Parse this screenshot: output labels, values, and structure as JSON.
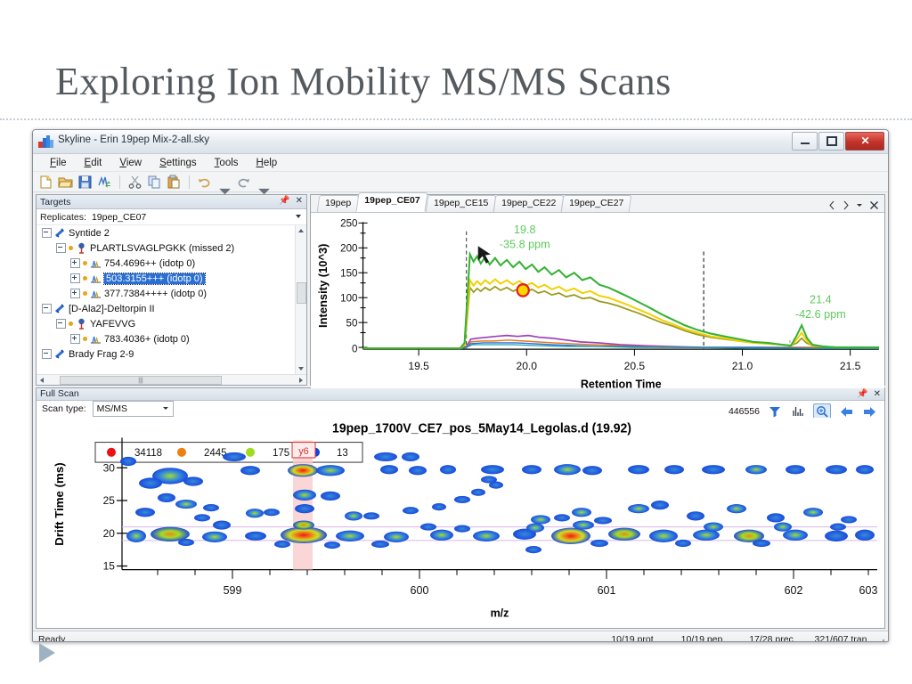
{
  "slide": {
    "title": "Exploring Ion Mobility MS/MS Scans"
  },
  "window": {
    "title": "Skyline - Erin 19pep Mix-2-all.sky",
    "icon": "skyline-app-icon",
    "controls": {
      "minimize": "minimize-icon",
      "maximize": "maximize-icon",
      "close": "close-icon",
      "close_glyph": "✕"
    }
  },
  "menu": {
    "items": [
      "File",
      "Edit",
      "View",
      "Settings",
      "Tools",
      "Help"
    ]
  },
  "toolbar": {
    "buttons": [
      {
        "name": "new-document-icon",
        "tip": "New"
      },
      {
        "name": "open-document-icon",
        "tip": "Open"
      },
      {
        "name": "save-document-icon",
        "tip": "Save"
      },
      {
        "name": "import-results-icon",
        "tip": "Import Results"
      },
      {
        "name": "cut-icon",
        "tip": "Cut"
      },
      {
        "name": "copy-icon",
        "tip": "Copy"
      },
      {
        "name": "paste-icon",
        "tip": "Paste"
      },
      {
        "name": "undo-icon",
        "tip": "Undo"
      },
      {
        "name": "redo-icon",
        "tip": "Redo"
      }
    ]
  },
  "targets": {
    "header": "Targets",
    "pin_icon": "pin-icon",
    "close_icon": "close-icon",
    "replicates_label": "Replicates:",
    "replicates_value": "19pep_CE07",
    "tree": [
      {
        "label": "Syntide 2",
        "level": 0,
        "icon": "protein-icon",
        "expander": "minus",
        "selected": false
      },
      {
        "label": "PLARTLSVAGLPGKK (missed 2)",
        "level": 1,
        "icon": "peptide-icon",
        "expander": "minus",
        "selected": false
      },
      {
        "label": "754.4696++ (idotp 0)",
        "level": 2,
        "icon": "precursor-icon",
        "expander": "plus",
        "selected": false
      },
      {
        "label": "503.3155+++ (idotp 0)",
        "level": 2,
        "icon": "precursor-icon",
        "expander": "plus",
        "selected": true
      },
      {
        "label": "377.7384++++ (idotp 0)",
        "level": 2,
        "icon": "precursor-icon",
        "expander": "plus",
        "selected": false
      },
      {
        "label": "[D-Ala2]-Deltorpin II",
        "level": 0,
        "icon": "protein-icon",
        "expander": "minus",
        "selected": false
      },
      {
        "label": "YAFEVVG",
        "level": 1,
        "icon": "peptide-icon",
        "expander": "minus",
        "selected": false
      },
      {
        "label": "783.4036+ (idotp 0)",
        "level": 2,
        "icon": "precursor-icon",
        "expander": "plus",
        "selected": false
      },
      {
        "label": "Brady Frag 2-9",
        "level": 0,
        "icon": "protein-icon",
        "expander": "minus",
        "selected": false
      }
    ]
  },
  "chromatogram_panel": {
    "tabs": [
      {
        "label": "19pep",
        "active": false
      },
      {
        "label": "19pep_CE07",
        "active": true
      },
      {
        "label": "19pep_CE15",
        "active": false
      },
      {
        "label": "19pep_CE22",
        "active": false
      },
      {
        "label": "19pep_CE27",
        "active": false
      }
    ],
    "tools": {
      "prev_icon": "prev-arrow-icon",
      "next_icon": "next-arrow-icon",
      "menu_icon": "chevron-down-icon",
      "close_icon": "close-icon"
    }
  },
  "full_scan": {
    "header": "Full Scan",
    "pin_icon": "pin-icon",
    "close_icon": "close-icon",
    "scan_type_label": "Scan type:",
    "scan_type_value": "MS/MS",
    "count": "446556",
    "tools": [
      {
        "name": "filter-icon",
        "active": false
      },
      {
        "name": "spectrum-icon",
        "active": false
      },
      {
        "name": "zoom-icon",
        "active": true
      },
      {
        "name": "back-arrow-icon",
        "active": false
      },
      {
        "name": "forward-arrow-icon",
        "active": false
      }
    ]
  },
  "status_bar": {
    "message": "Ready",
    "cells": [
      "10/19 prot",
      "10/19 pep",
      "17/28 prec",
      "321/607 tran"
    ],
    "grip_icon": "resize-grip-icon"
  },
  "chart_data": [
    {
      "id": "chromatogram",
      "type": "line",
      "title": "",
      "xlabel": "Retention Time",
      "ylabel": "Intensity (10^3)",
      "xlim": [
        19.22,
        21.62
      ],
      "ylim": [
        0,
        262
      ],
      "xticks": [
        19.5,
        20.0,
        20.5,
        21.0,
        21.5
      ],
      "xticklabels": [
        "19.5",
        "20.0",
        "20.5",
        "21.0",
        "21.5"
      ],
      "yticks": [
        0,
        50,
        100,
        150,
        200,
        250
      ],
      "yticklabels": [
        "0",
        "50",
        "100",
        "150",
        "200",
        "250"
      ],
      "grid": false,
      "annotations": [
        {
          "text": "19.8",
          "sub": "-35.8 ppm",
          "x": 19.98,
          "y": 238,
          "color": "#5ec95e"
        },
        {
          "text": "21.4",
          "sub": "-42.6 ppm",
          "x": 21.27,
          "y": 92,
          "color": "#5ec95e"
        }
      ],
      "markers": [
        {
          "name": "retention-time-marker",
          "x": 19.72,
          "style": "dashed"
        },
        {
          "name": "retention-time-marker-2",
          "x": 20.82,
          "style": "dashed"
        }
      ],
      "peak_marker": {
        "name": "selected-peak-dot",
        "x": 19.92,
        "y": 133,
        "fill": "#ffd700",
        "stroke": "#e02020"
      },
      "cursor": {
        "name": "cursor-arrow",
        "x": 19.76,
        "y": 196
      },
      "series": [
        {
          "name": "transition-green",
          "color": "#34b233",
          "x": [
            19.22,
            19.4,
            19.6,
            19.7,
            19.73,
            19.76,
            19.79,
            19.82,
            19.86,
            19.9,
            19.94,
            19.98,
            20.02,
            20.06,
            20.1,
            20.14,
            20.18,
            20.22,
            20.26,
            20.3,
            20.34,
            20.38,
            20.42,
            20.46,
            20.5,
            20.56,
            20.62,
            20.7,
            20.8,
            20.95,
            21.1,
            21.25,
            21.35,
            21.4,
            21.45,
            21.55,
            21.62
          ],
          "y": [
            1,
            1,
            1,
            2,
            12,
            190,
            175,
            185,
            168,
            172,
            178,
            160,
            172,
            150,
            160,
            138,
            148,
            128,
            140,
            120,
            128,
            112,
            118,
            100,
            95,
            72,
            58,
            42,
            28,
            18,
            13,
            11,
            9,
            26,
            9,
            7,
            6
          ]
        },
        {
          "name": "transition-yellow",
          "color": "#f2d000",
          "x": [
            19.22,
            19.4,
            19.6,
            19.7,
            19.73,
            19.76,
            19.79,
            19.82,
            19.86,
            19.9,
            19.94,
            19.98,
            20.02,
            20.06,
            20.1,
            20.14,
            20.18,
            20.22,
            20.26,
            20.3,
            20.34,
            20.38,
            20.42,
            20.46,
            20.5,
            20.56,
            20.62,
            20.7,
            20.8,
            20.95,
            21.1,
            21.25,
            21.35,
            21.4,
            21.45,
            21.55,
            21.62
          ],
          "y": [
            1,
            1,
            1,
            2,
            10,
            138,
            126,
            133,
            122,
            128,
            132,
            118,
            128,
            112,
            120,
            104,
            110,
            96,
            102,
            86,
            92,
            80,
            84,
            70,
            66,
            50,
            40,
            30,
            20,
            13,
            9,
            8,
            7,
            16,
            7,
            5,
            5
          ]
        },
        {
          "name": "transition-olive",
          "color": "#9a9a1c",
          "x": [
            19.22,
            19.4,
            19.6,
            19.7,
            19.73,
            19.76,
            19.79,
            19.82,
            19.86,
            19.9,
            19.94,
            19.98,
            20.02,
            20.06,
            20.1,
            20.14,
            20.18,
            20.22,
            20.26,
            20.3,
            20.34,
            20.38,
            20.42,
            20.46,
            20.5,
            20.56,
            20.62,
            20.7,
            20.8,
            20.95,
            21.1,
            21.25,
            21.35,
            21.4,
            21.45,
            21.55,
            21.62
          ],
          "y": [
            1,
            1,
            1,
            2,
            8,
            124,
            112,
            117,
            108,
            112,
            118,
            104,
            112,
            96,
            104,
            88,
            94,
            80,
            86,
            72,
            78,
            66,
            70,
            58,
            54,
            40,
            32,
            24,
            16,
            10,
            8,
            7,
            6,
            12,
            6,
            5,
            4
          ]
        },
        {
          "name": "transition-purple",
          "color": "#9b3fb5",
          "x": [
            19.22,
            19.4,
            19.6,
            19.7,
            19.73,
            19.76,
            19.8,
            19.86,
            19.92,
            19.98,
            20.06,
            20.14,
            20.22,
            20.32,
            20.42,
            20.52,
            20.65,
            20.8,
            21.0,
            21.2,
            21.4,
            21.62
          ],
          "y": [
            1,
            1,
            1,
            2,
            4,
            20,
            22,
            24,
            26,
            28,
            26,
            28,
            24,
            22,
            18,
            14,
            11,
            8,
            6,
            5,
            6,
            5
          ]
        },
        {
          "name": "transition-orange",
          "color": "#e87722",
          "x": [
            19.22,
            19.4,
            19.6,
            19.7,
            19.73,
            19.76,
            19.8,
            19.86,
            19.92,
            19.98,
            20.06,
            20.14,
            20.22,
            20.32,
            20.42,
            20.52,
            20.65,
            20.8,
            21.0,
            21.2,
            21.4,
            21.62
          ],
          "y": [
            1,
            1,
            1,
            2,
            3,
            14,
            16,
            17,
            18,
            19,
            18,
            19,
            17,
            15,
            12,
            10,
            8,
            6,
            4,
            3,
            4,
            3
          ]
        },
        {
          "name": "transition-blue",
          "color": "#2a6fd4",
          "x": [
            19.22,
            19.4,
            19.6,
            19.7,
            19.73,
            19.76,
            19.8,
            19.86,
            19.92,
            19.98,
            20.06,
            20.14,
            20.22,
            20.32,
            20.42,
            20.52,
            20.65,
            20.8,
            21.0,
            21.2,
            21.4,
            21.62
          ],
          "y": [
            1,
            1,
            1,
            2,
            3,
            10,
            12,
            13,
            14,
            14,
            13,
            14,
            12,
            11,
            9,
            7,
            6,
            5,
            4,
            3,
            5,
            4
          ]
        }
      ]
    },
    {
      "id": "full-scan-ion-mobility-heatmap",
      "type": "heatmap",
      "title": "19pep_1700V_CE7_pos_5May14_Legolas.d (19.92)",
      "xlabel": "m/z",
      "ylabel": "Drift Time (ms)",
      "xlim": [
        598.35,
        603.6
      ],
      "ylim": [
        14.2,
        32.5
      ],
      "xticks": [
        599,
        600,
        601,
        602,
        603
      ],
      "xticklabels": [
        "599",
        "600",
        "601",
        "602",
        "603"
      ],
      "yticks": [
        15,
        20,
        25,
        30
      ],
      "yticklabels": [
        "15",
        "20",
        "25",
        "30"
      ],
      "legend": {
        "position": "top-left",
        "entries": [
          {
            "label": "34118",
            "color": "#ee1111"
          },
          {
            "label": "2445",
            "color": "#f07f10"
          },
          {
            "label": "175",
            "color": "#9fdc20"
          },
          {
            "label": "13",
            "color": "#1144dd"
          }
        ]
      },
      "annotations": [
        {
          "name": "fragment-label",
          "text": "y6",
          "x": 599.52,
          "color": "#d83434",
          "highlight": "#f8c9c9"
        }
      ]
    }
  ]
}
